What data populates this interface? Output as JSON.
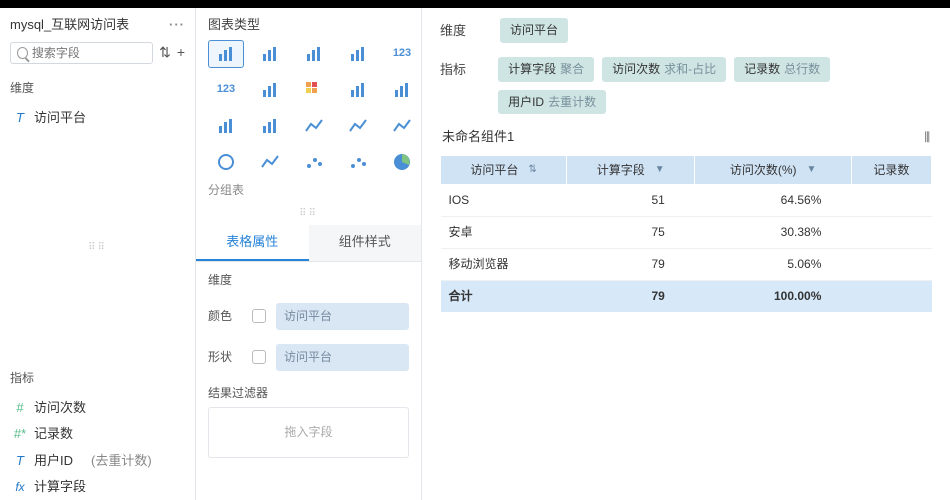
{
  "left": {
    "source": "mysql_互联网访问表",
    "search_placeholder": "搜索字段",
    "dim_label": "维度",
    "dims": [
      "访问平台"
    ],
    "meas_label": "指标",
    "meas": [
      {
        "label": "访问次数"
      },
      {
        "label": "记录数"
      },
      {
        "label": "用户ID",
        "note": "(去重计数)"
      },
      {
        "label": "计算字段"
      }
    ]
  },
  "mid": {
    "title": "图表类型",
    "group_label": "分组表",
    "tabs": [
      "表格属性",
      "组件样式"
    ],
    "props": {
      "dim": "维度",
      "color": "颜色",
      "shape": "形状",
      "bound": "访问平台"
    },
    "filter_title": "结果过滤器",
    "drag_hint": "拖入字段",
    "chart_types": [
      {
        "name": "table",
        "sel": true
      },
      {
        "name": "grid"
      },
      {
        "name": "matrix"
      },
      {
        "name": "kpi-tiles"
      },
      {
        "name": "number",
        "txt": "123"
      },
      {
        "name": "num-grid",
        "txt": "123"
      },
      {
        "name": "pivot"
      },
      {
        "name": "heatgrid"
      },
      {
        "name": "column-grouped"
      },
      {
        "name": "column"
      },
      {
        "name": "col-stack"
      },
      {
        "name": "bar-stack"
      },
      {
        "name": "line-multi"
      },
      {
        "name": "line"
      },
      {
        "name": "area"
      },
      {
        "name": "gauge"
      },
      {
        "name": "sparkline"
      },
      {
        "name": "scatter"
      },
      {
        "name": "bubble"
      },
      {
        "name": "pie"
      }
    ]
  },
  "right": {
    "dim_label": "维度",
    "dim_chips": [
      {
        "name": "访问平台"
      }
    ],
    "meas_label": "指标",
    "meas_chips": [
      {
        "name": "计算字段",
        "agg": "聚合"
      },
      {
        "name": "访问次数",
        "agg": "求和-占比"
      },
      {
        "name": "记录数",
        "agg": "总行数"
      },
      {
        "name": "用户ID",
        "agg": "去重计数"
      }
    ],
    "widget_title": "未命名组件1",
    "columns": [
      "访问平台",
      "计算字段",
      "访问次数(%)",
      "记录数"
    ],
    "rows": [
      {
        "platform": "IOS",
        "calc": "51",
        "pct": "64.56%",
        "rec": ""
      },
      {
        "platform": "安卓",
        "calc": "75",
        "pct": "30.38%",
        "rec": ""
      },
      {
        "platform": "移动浏览器",
        "calc": "79",
        "pct": "5.06%",
        "rec": ""
      }
    ],
    "total": {
      "label": "合计",
      "calc": "79",
      "pct": "100.00%",
      "rec": ""
    }
  },
  "chart_data": {
    "type": "table",
    "title": "未命名组件1",
    "columns": [
      "访问平台",
      "计算字段",
      "访问次数(%)",
      "记录数"
    ],
    "rows": [
      [
        "IOS",
        51,
        "64.56%",
        null
      ],
      [
        "安卓",
        75,
        "30.38%",
        null
      ],
      [
        "移动浏览器",
        79,
        "5.06%",
        null
      ]
    ],
    "total": [
      "合计",
      79,
      "100.00%",
      null
    ]
  }
}
